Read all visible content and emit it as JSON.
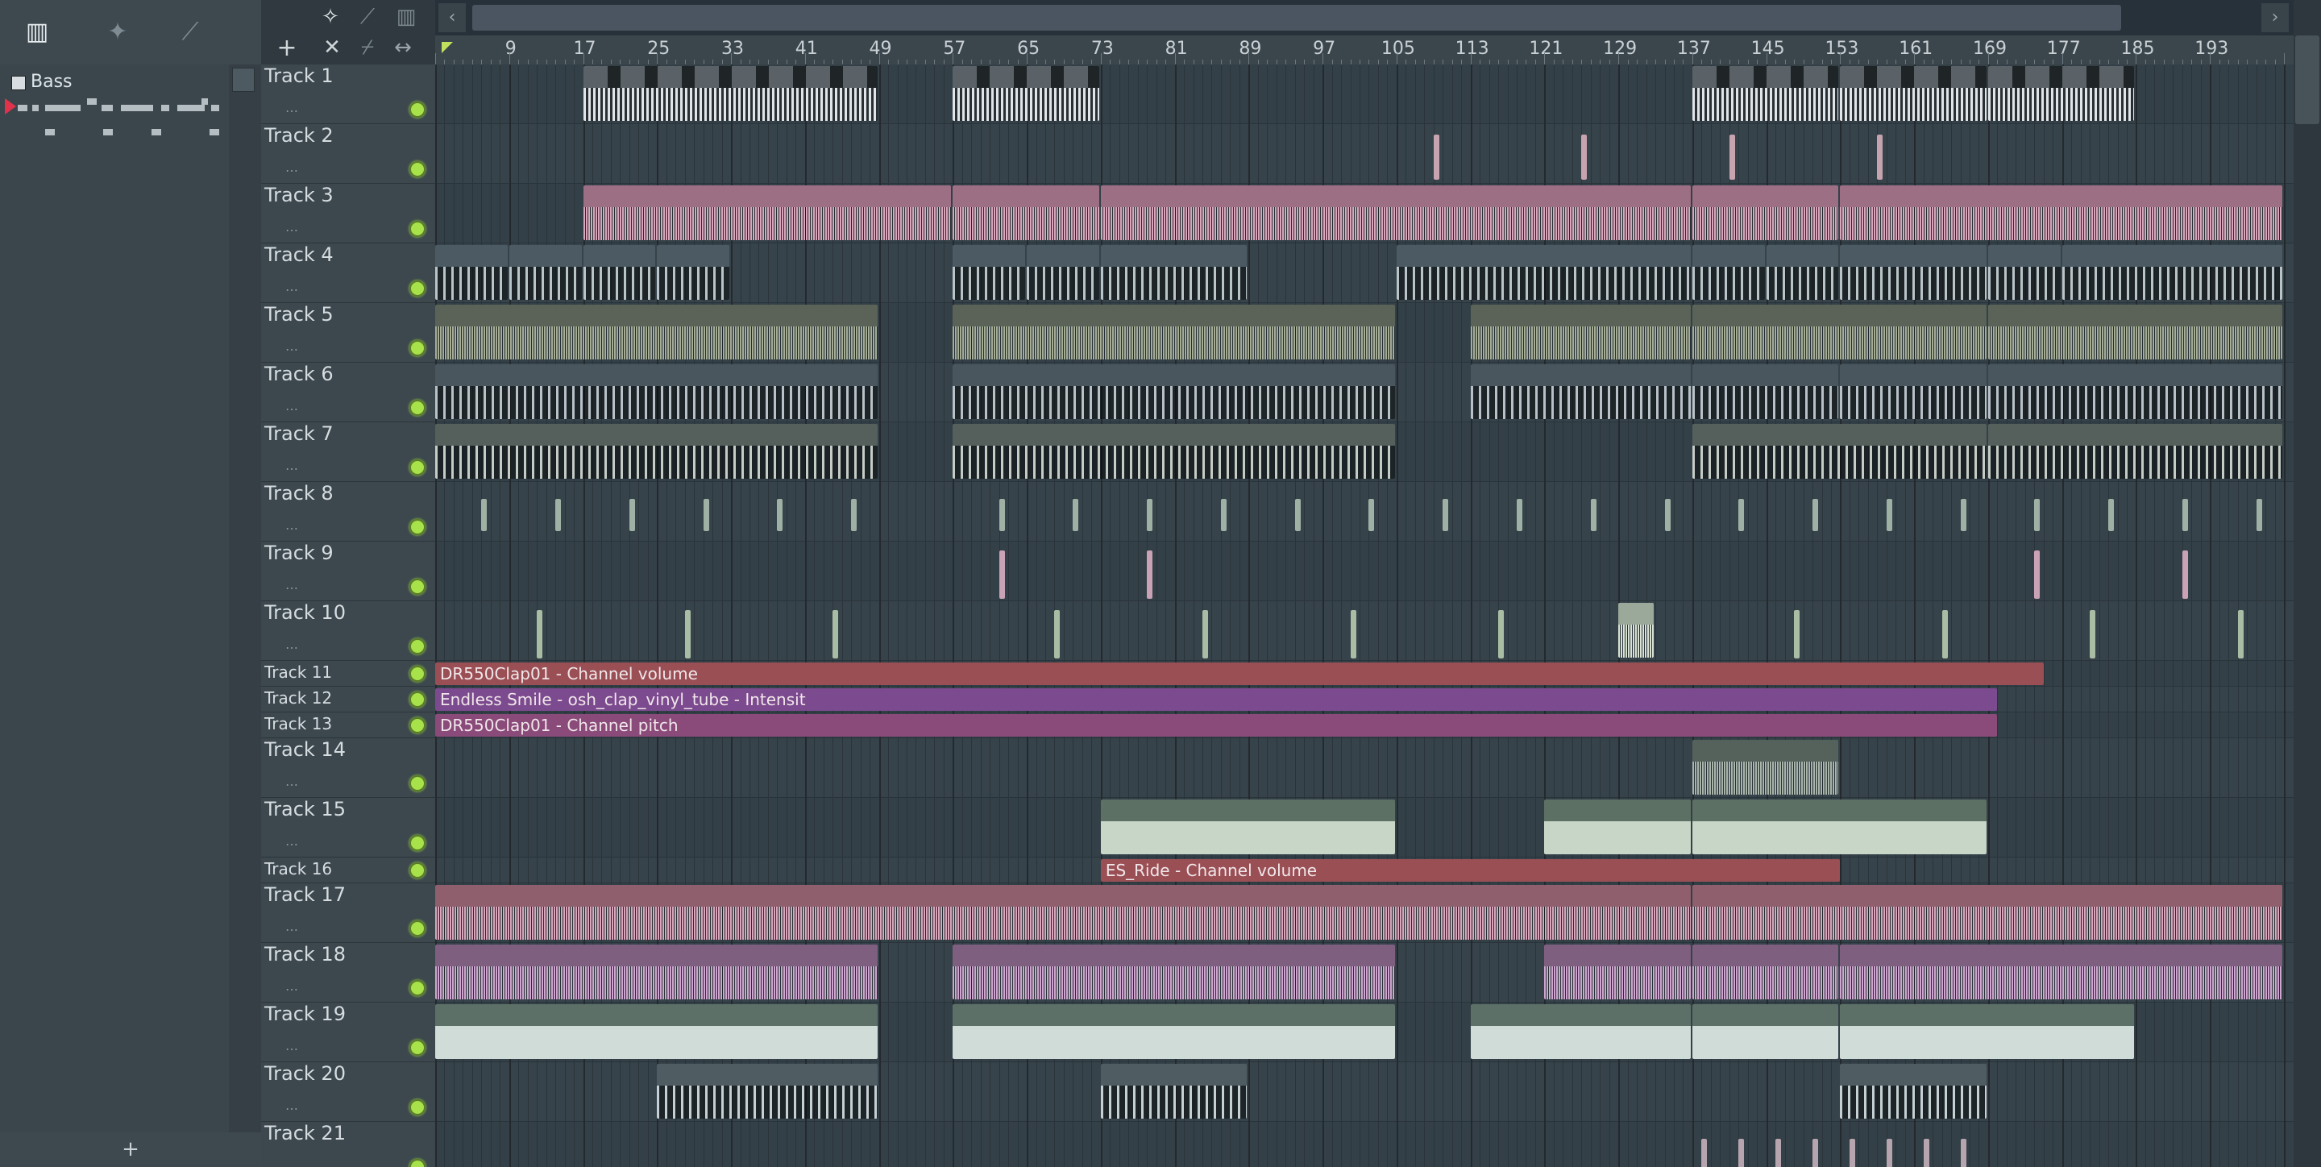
{
  "picker": {
    "pattern_name": "Bass",
    "add_label": "+"
  },
  "toolbar": {
    "add_track_label": "+",
    "close_label": "✕"
  },
  "ruler": {
    "bars": [
      "9",
      "17",
      "25",
      "33",
      "41",
      "49",
      "57",
      "65",
      "73",
      "81",
      "89",
      "97",
      "105",
      "113",
      "121",
      "129",
      "137",
      "145",
      "153",
      "161",
      "169",
      "177",
      "185",
      "193"
    ]
  },
  "tracks": [
    {
      "name": "Track 1"
    },
    {
      "name": "Track 2"
    },
    {
      "name": "Track 3"
    },
    {
      "name": "Track 4"
    },
    {
      "name": "Track 5"
    },
    {
      "name": "Track 6"
    },
    {
      "name": "Track 7"
    },
    {
      "name": "Track 8"
    },
    {
      "name": "Track 9"
    },
    {
      "name": "Track 10"
    },
    {
      "name": "Track 11"
    },
    {
      "name": "Track 12"
    },
    {
      "name": "Track 13"
    },
    {
      "name": "Track 14"
    },
    {
      "name": "Track 15"
    },
    {
      "name": "Track 16"
    },
    {
      "name": "Track 17"
    },
    {
      "name": "Track 18"
    },
    {
      "name": "Track 19"
    },
    {
      "name": "Track 20"
    },
    {
      "name": "Track 21"
    }
  ],
  "automation": {
    "t11": "DR550Clap01 - Channel volume",
    "t12": "Endless Smile - osh_clap_vinyl_tube - Intensit",
    "t13": "DR550Clap01 - Channel pitch",
    "t16": "ES_Ride - Channel volume"
  },
  "colors": {
    "accent_green": "#a7e24a",
    "clip_pink": "#d9a6bb",
    "clip_mauve": "#8f5f78",
    "automation_red": "#9a4f55",
    "automation_purple": "#7c4a8e",
    "automation_magenta": "#8a4a7a"
  }
}
